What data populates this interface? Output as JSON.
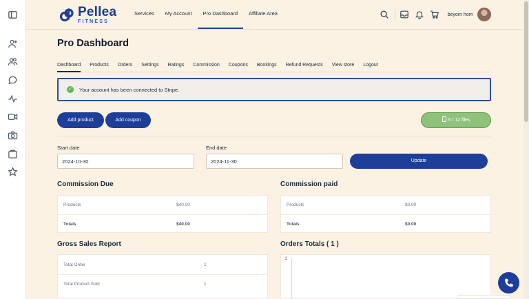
{
  "brand": {
    "name": "Pellea",
    "sub": "FITNESS",
    "primary_color": "#1d3f9a"
  },
  "rail_icons": [
    "sidebar-toggle-icon",
    "user-plus-icon",
    "users-icon",
    "chat-icon",
    "activity-icon",
    "video-icon",
    "camera-icon",
    "gallery-icon",
    "star-icon"
  ],
  "topnav": {
    "items": [
      {
        "label": "Services"
      },
      {
        "label": "My Account"
      },
      {
        "label": "Pro Dashboard",
        "active": true
      },
      {
        "label": "Affiliate Area"
      }
    ]
  },
  "header": {
    "icons": [
      "search-icon",
      "inbox-icon",
      "bell-icon",
      "cart-icon"
    ],
    "username": "beyorn horn"
  },
  "page": {
    "title": "Pro Dashboard"
  },
  "tabs": [
    {
      "label": "Dashboard",
      "active": true
    },
    {
      "label": "Products"
    },
    {
      "label": "Orders"
    },
    {
      "label": "Settings"
    },
    {
      "label": "Ratings"
    },
    {
      "label": "Commission"
    },
    {
      "label": "Coupons"
    },
    {
      "label": "Bookings"
    },
    {
      "label": "Refund Requests"
    },
    {
      "label": "View store"
    },
    {
      "label": "Logout"
    }
  ],
  "alert": {
    "text": "Your account has been connected to Stripe."
  },
  "actions": {
    "add_product": "Add product",
    "add_coupon": "Add coupon",
    "files": "5 / 12 files"
  },
  "filters": {
    "start_label": "Start date",
    "start_value": "2024-10-30",
    "end_label": "End date",
    "end_value": "2024-11-30",
    "update": "Update"
  },
  "commission_due": {
    "title": "Commission Due",
    "rows": [
      {
        "label": "Products",
        "value": "$40.00"
      },
      {
        "label": "Totals",
        "value": "$40.00"
      }
    ]
  },
  "commission_paid": {
    "title": "Commission paid",
    "rows": [
      {
        "label": "Products",
        "value": "$0.00"
      },
      {
        "label": "Totals",
        "value": "$0.00"
      }
    ]
  },
  "gross_sales": {
    "title": "Gross Sales Report",
    "rows": [
      {
        "label": "Total Order",
        "value": "1"
      },
      {
        "label": "Total Product Sold",
        "value": "1"
      }
    ]
  },
  "orders_totals": {
    "title": "Orders Totals ( 1 )",
    "y_tick": "2"
  }
}
